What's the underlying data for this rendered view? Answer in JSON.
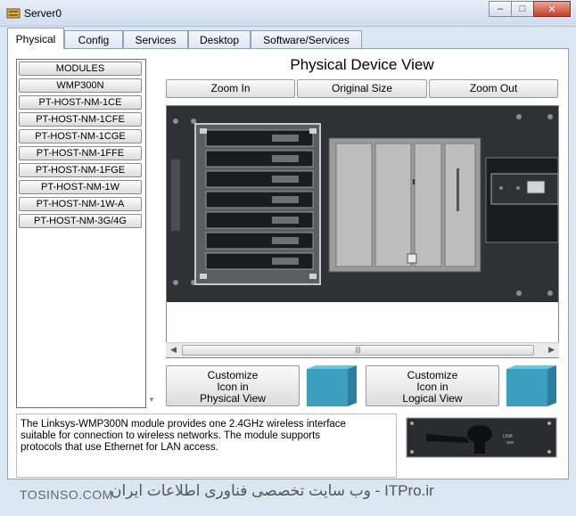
{
  "window": {
    "title": "Server0"
  },
  "tabs": [
    {
      "label": "Physical"
    },
    {
      "label": "Config"
    },
    {
      "label": "Services"
    },
    {
      "label": "Desktop"
    },
    {
      "label": "Software/Services"
    }
  ],
  "modules": [
    "MODULES",
    "WMP300N",
    "PT-HOST-NM-1CE",
    "PT-HOST-NM-1CFE",
    "PT-HOST-NM-1CGE",
    "PT-HOST-NM-1FFE",
    "PT-HOST-NM-1FGE",
    "PT-HOST-NM-1W",
    "PT-HOST-NM-1W-A",
    "PT-HOST-NM-3G/4G"
  ],
  "device_view": {
    "title": "Physical Device View",
    "zoom_in": "Zoom In",
    "original_size": "Original Size",
    "zoom_out": "Zoom Out",
    "scroll_grip": "|||"
  },
  "customize": {
    "physical": [
      "Customize",
      "Icon in",
      "Physical View"
    ],
    "logical": [
      "Customize",
      "Icon in",
      "Logical View"
    ]
  },
  "description": {
    "lines": [
      "The Linksys-WMP300N module provides one 2.4GHz wireless interface",
      "suitable for connection to wireless networks. The module supports",
      "protocols that use Ethernet for LAN access."
    ]
  },
  "module_image": {
    "label": "LINK"
  },
  "watermark": {
    "left": "TOSINSO.COM",
    "right": "ITPro.ir - وب سایت تخصصی فناوری اطلاعات ایران"
  },
  "colors": {
    "accent_underline": "#d51e2b",
    "cube": "#3d9fbf"
  }
}
